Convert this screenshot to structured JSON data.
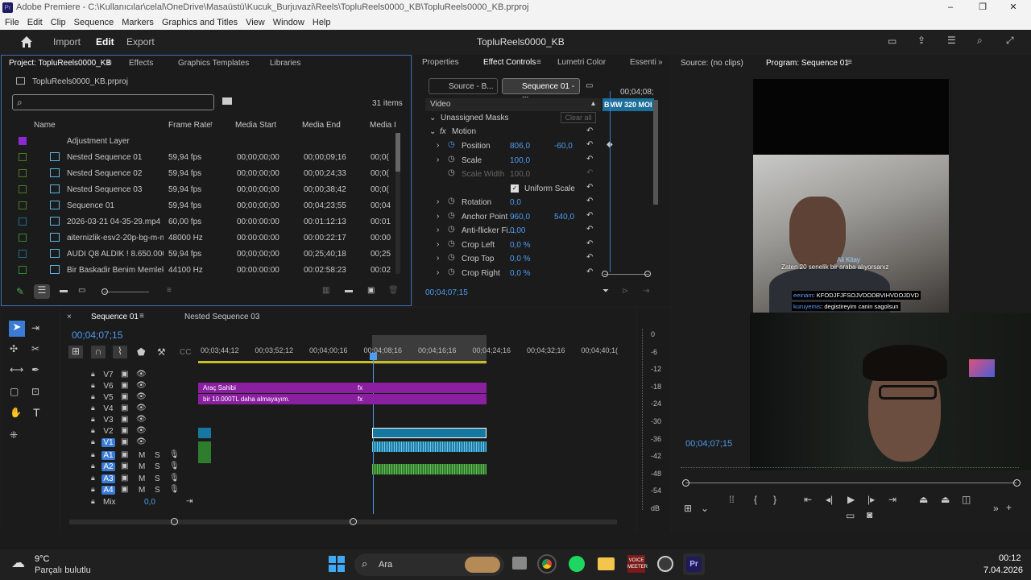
{
  "window": {
    "app_icon": "Pr",
    "title": "Adobe Premiere - C:\\Kullanıcılar\\celal\\OneDrive\\Masaüstü\\Kucuk_Burjuvazi\\Reels\\TopluReels0000_KB\\TopluReels0000_KB.prproj"
  },
  "menu": [
    "File",
    "Edit",
    "Clip",
    "Sequence",
    "Markers",
    "Graphics and Titles",
    "View",
    "Window",
    "Help"
  ],
  "header": {
    "import": "Import",
    "edit": "Edit",
    "export": "Export",
    "project_name": "TopluReels0000_KB"
  },
  "project": {
    "tabs": [
      "Project: TopluReels0000_KB",
      "Effects",
      "Graphics Templates",
      "Libraries"
    ],
    "file": "TopluReels0000_KB.prproj",
    "item_count": "31 items",
    "columns": [
      "Name",
      "Frame Rate",
      "Media Start",
      "Media End",
      "Media I"
    ],
    "rows": [
      {
        "name": "Adjustment Layer",
        "rate": "",
        "start": "",
        "end": "",
        "in": "",
        "color": "#8a2bd0"
      },
      {
        "name": "Nested Sequence 01",
        "rate": "59,94 fps",
        "start": "00;00;00;00",
        "end": "00;00;09;16",
        "in": "00;0(",
        "color": "#4b7a1f"
      },
      {
        "name": "Nested Sequence 02",
        "rate": "59,94 fps",
        "start": "00;00;00;00",
        "end": "00;00;24;33",
        "in": "00;0(",
        "color": "#4b7a1f"
      },
      {
        "name": "Nested Sequence 03",
        "rate": "59,94 fps",
        "start": "00;00;00;00",
        "end": "00;00;38;42",
        "in": "00;0(",
        "color": "#4b7a1f"
      },
      {
        "name": "Sequence 01",
        "rate": "59,94 fps",
        "start": "00;00;00;00",
        "end": "00;04;23;55",
        "in": "00;04",
        "color": "#4b7a1f"
      },
      {
        "name": "2026-03-21 04-35-29.mp4",
        "rate": "60,00 fps",
        "start": "00:00:00:00",
        "end": "00:01:12:13",
        "in": "00:01",
        "color": "#1a6f8c"
      },
      {
        "name": "aiternizlik-esv2-20p-bg-m-m",
        "rate": "48000 Hz",
        "start": "00:00:00:00",
        "end": "00:00:22:17",
        "in": "00:00",
        "color": "#2e8b2e"
      },
      {
        "name": "AUDI Q8 ALDIK ! 8.650.000 T",
        "rate": "59,94 fps",
        "start": "00;00;00;00",
        "end": "00;25;40;18",
        "in": "00;25",
        "color": "#1a6f8c"
      },
      {
        "name": "Bir Baskadir Benim Memleke",
        "rate": "44100 Hz",
        "start": "00:00:00:00",
        "end": "00:02:58:23",
        "in": "00:02",
        "color": "#2e8b2e"
      }
    ]
  },
  "effect": {
    "tabs": [
      "Properties",
      "Effect Controls",
      "Lumetri Color",
      "Essenti"
    ],
    "source_btn": "Source - B...",
    "seq_btn": "Sequence 01 - ...",
    "timecode_mini": "00;04;08;",
    "clip_mini": "BMW 320 MOI",
    "video": "Video",
    "masks": "Unassigned Masks",
    "clear": "Clear all",
    "motion": "Motion",
    "props": [
      {
        "name": "Position",
        "v1": "806,0",
        "v2": "-60,0"
      },
      {
        "name": "Scale",
        "v1": "100,0",
        "v2": ""
      },
      {
        "name": "Scale Width",
        "v1": "100,0",
        "v2": ""
      },
      {
        "name": "Uniform Scale",
        "v1": "",
        "v2": ""
      },
      {
        "name": "Rotation",
        "v1": "0,0",
        "v2": ""
      },
      {
        "name": "Anchor Point",
        "v1": "960,0",
        "v2": "540,0"
      },
      {
        "name": "Anti-flicker Fi...",
        "v1": "0,00",
        "v2": ""
      },
      {
        "name": "Crop Left",
        "v1": "0,0 %",
        "v2": ""
      },
      {
        "name": "Crop Top",
        "v1": "0,0 %",
        "v2": ""
      },
      {
        "name": "Crop Right",
        "v1": "0,0 %",
        "v2": ""
      }
    ],
    "timecode": "00;04;07;15"
  },
  "monitor": {
    "source": "Source: (no clips)",
    "program": "Program: Sequence 01",
    "timecode": "00;04;07;15",
    "caption_name": "Ali Kitay",
    "caption_text": "Zaten 20 senelik bir araba alıyorsanız",
    "chat1_user": "eeinam",
    "chat1_text": ": KFODJFJFSOJVDODBVIHVDOJDVD",
    "chat2_user": "kuruyemis",
    "chat2_text": ": degistireyim canin sagolsun"
  },
  "timeline": {
    "tabs": [
      "Sequence 01",
      "Nested Sequence 03"
    ],
    "timecode": "00;04;07;15",
    "ruler": [
      "00;03;44;12",
      "00;03;52;12",
      "00;04;00;16",
      "00;04;08;16",
      "00;04;16;16",
      "00;04;24;16",
      "00;04;32;16",
      "00;04;40;1("
    ],
    "vtracks": [
      "V7",
      "V6",
      "V5",
      "V4",
      "V3",
      "V2",
      "V1"
    ],
    "atracks": [
      "A1",
      "A2",
      "A3",
      "A4"
    ],
    "mix": "Mix",
    "mix_val": "0,0",
    "clip1": "Araç Sahibi",
    "clip2": "bir 10.000TL daha almayayım.",
    "meter": [
      "0",
      "-6",
      "-12",
      "-18",
      "-24",
      "-30",
      "-36",
      "-42",
      "-48",
      "-54",
      "dB"
    ]
  },
  "taskbar": {
    "temp": "9°C",
    "weather": "Parçalı bulutlu",
    "search": "Ara",
    "time": "00:12",
    "date": "7.04.2026",
    "voicemeeter": "VOICE MEETER"
  }
}
